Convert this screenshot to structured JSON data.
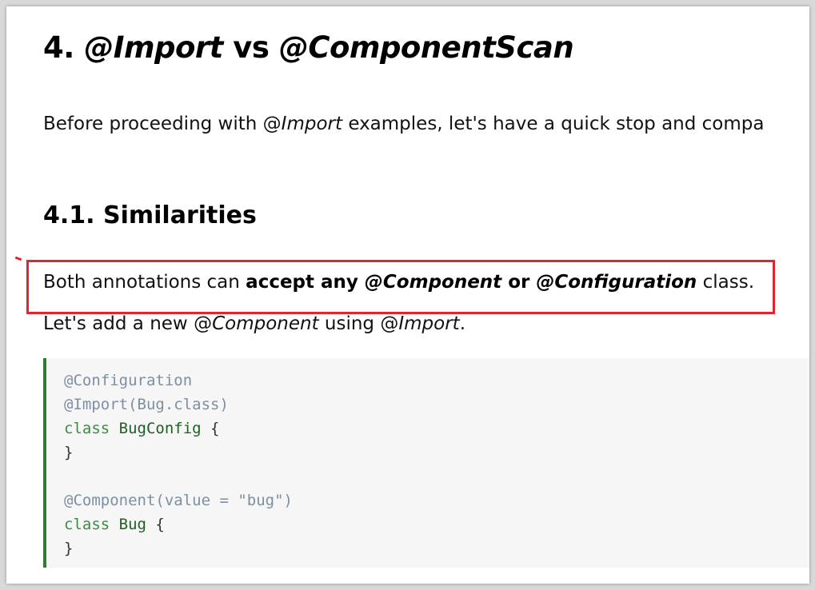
{
  "article": {
    "heading": {
      "number": "4.",
      "import": "@Import",
      "vs": "vs",
      "scan": "@ComponentScan"
    },
    "intro": {
      "before": "Before proceeding with ",
      "at": "@",
      "import": "Import",
      "after": " examples, let's have a quick stop and compa"
    },
    "subheading": "4.1. Similarities",
    "similarity": {
      "t1": "Both annotations can ",
      "t2": "accept any ",
      "t3": "@Component",
      "t4": " or ",
      "t5": "@Configuration",
      "t6": " class."
    },
    "add_line": {
      "t1": "Let's add a new ",
      "at1": "@",
      "component": "Component",
      "t2": " using ",
      "at2": "@",
      "import": "Import",
      "t3": "."
    }
  },
  "code": {
    "l1": "@Configuration",
    "l2": "@Import(Bug.class)",
    "l3_kw": "class",
    "l3_name": " BugConfig",
    "l3_brace": " {",
    "l4": "}",
    "l6": "@Component(value = \"bug\")",
    "l7_kw": "class",
    "l7_name": " Bug",
    "l7_brace": " {",
    "l8": "}"
  },
  "colors": {
    "highlight_border": "#e2242f",
    "code_accent": "#2e7d32",
    "code_background": "#f6f6f6"
  }
}
